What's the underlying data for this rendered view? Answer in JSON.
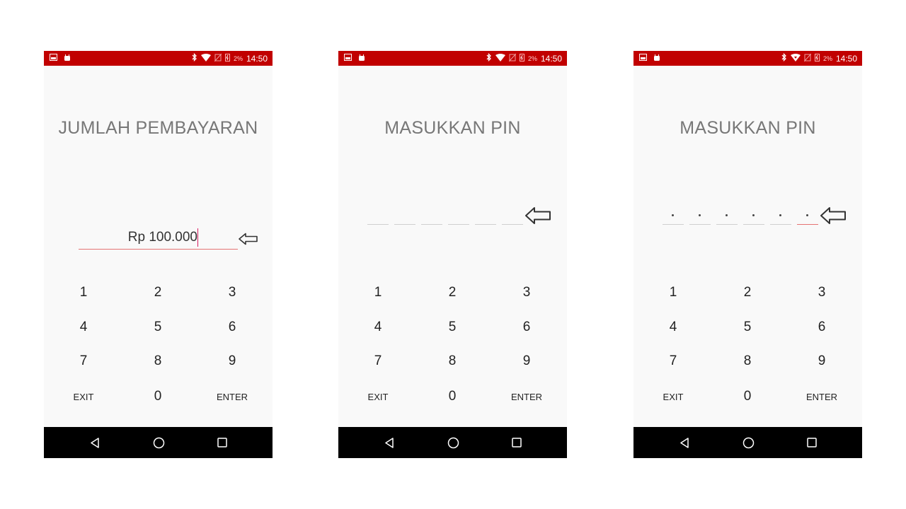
{
  "status_bar": {
    "time": "14:50",
    "battery_percent": "2%",
    "icons": [
      "image-icon",
      "android-icon",
      "bluetooth-icon",
      "wifi-icon",
      "no-sim-icon",
      "battery-charging-icon"
    ]
  },
  "screens": [
    {
      "title": "JUMLAH PEMBAYARAN",
      "amount_value": "Rp 100.000",
      "type": "amount"
    },
    {
      "title": "MASUKKAN PIN",
      "type": "pin",
      "pin_length": 6,
      "pin_filled": 0
    },
    {
      "title": "MASUKKAN PIN",
      "type": "pin",
      "pin_length": 6,
      "pin_filled": 6
    }
  ],
  "keypad": {
    "k1": "1",
    "k2": "2",
    "k3": "3",
    "k4": "4",
    "k5": "5",
    "k6": "6",
    "k7": "7",
    "k8": "8",
    "k9": "9",
    "exit": "EXIT",
    "k0": "0",
    "enter": "ENTER"
  },
  "colors": {
    "status_bar": "#c10000",
    "accent_underline": "#e57373",
    "title_gray": "#777777",
    "nav_bar": "#000000"
  },
  "nav_icons": [
    "back-icon",
    "home-icon",
    "recents-icon"
  ]
}
